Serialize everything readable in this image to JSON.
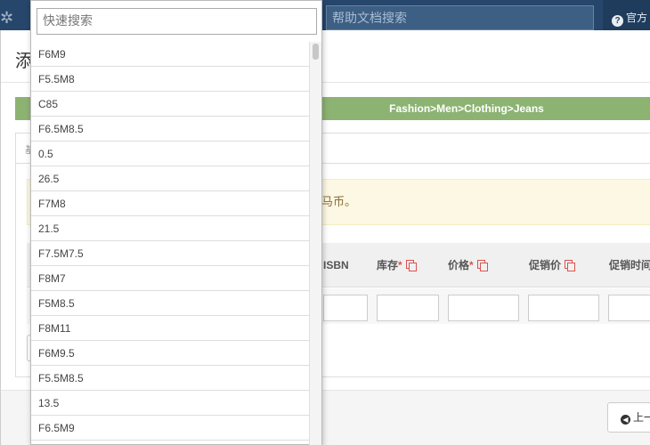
{
  "topbar": {
    "help_search_placeholder": "帮助文档搜索",
    "right_link": "官方"
  },
  "modal": {
    "title_fragment": "添",
    "category_path": "Fashion>Men>Clothing>Jeans",
    "tab_fragment": "基",
    "notice_fragment": "马币。",
    "columns": [
      {
        "label": "ISBN",
        "required": ""
      },
      {
        "label": "库存",
        "required": "*"
      },
      {
        "label": "价格",
        "required": "*"
      },
      {
        "label": "促销价",
        "required": ""
      },
      {
        "label": "促销时间",
        "required": ""
      }
    ],
    "prev_button": "上一"
  },
  "dropdown": {
    "search_placeholder": "快速搜索",
    "options": [
      "F6M9",
      "F5.5M8",
      "C85",
      "F6.5M8.5",
      "0.5",
      "26.5",
      "F7M8",
      "21.5",
      "F7.5M7.5",
      "F8M7",
      "F5M8.5",
      "F8M11",
      "F6M9.5",
      "F5.5M8.5",
      "13.5",
      "F6.5M9"
    ]
  }
}
